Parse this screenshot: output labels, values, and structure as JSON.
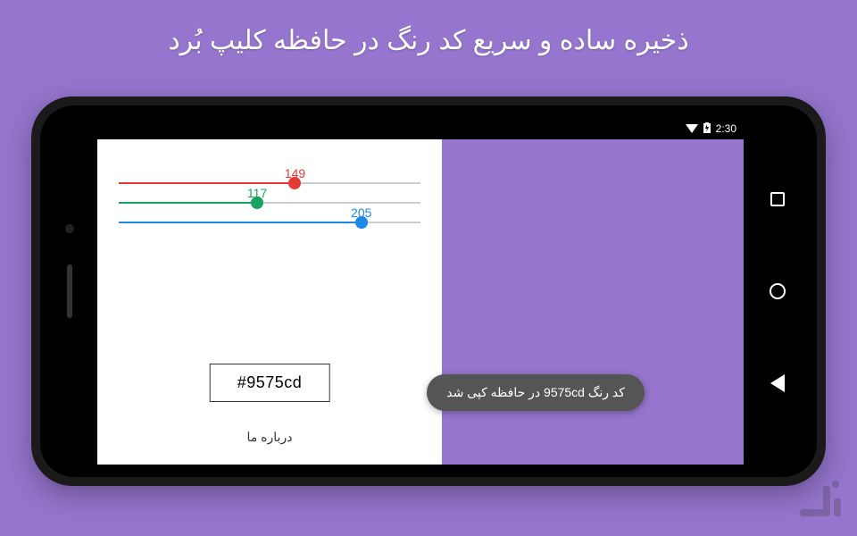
{
  "headline": "ذخیره ساده و سریع کد رنگ در حافظه کلیپ بُرد",
  "statusbar": {
    "time": "2:30"
  },
  "sliders": {
    "red": {
      "value": 149,
      "max": 255
    },
    "green": {
      "value": 117,
      "max": 255
    },
    "blue": {
      "value": 205,
      "max": 255
    }
  },
  "hex": "#9575cd",
  "preview_color": "#9575cd",
  "toast": "کد رنگ 9575cd در حافظه کپی شد",
  "about_label": "درباره ما"
}
